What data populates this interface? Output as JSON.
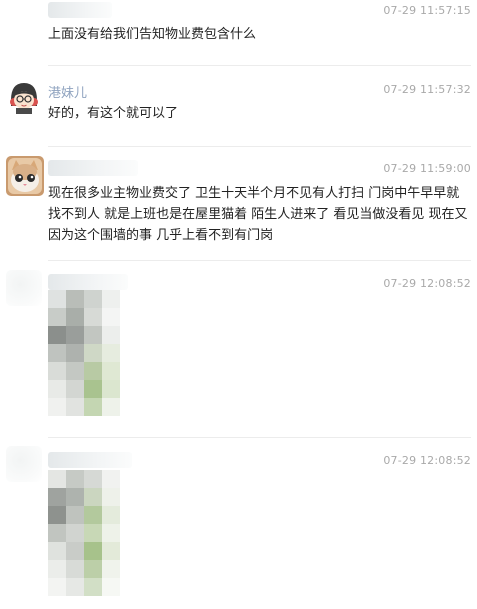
{
  "comments": [
    {
      "author": "",
      "time": "07-29 11:57:15",
      "text": "上面没有给我们告知物业费包含什么"
    },
    {
      "author": "港妹儿",
      "time": "07-29 11:57:32",
      "text": "好的，有这个就可以了"
    },
    {
      "author": "",
      "time": "07-29 11:59:00",
      "text": "现在很多业主物业费交了 卫生十天半个月不见有人打扫 门岗中午早早就找不到人 就是上班也是在屋里猫着 陌生人进来了 看见当做没看见 现在又因为这个围墙的事 几乎上看不到有门岗"
    },
    {
      "author": "",
      "time": "07-29 12:08:52",
      "text": "",
      "image": "blurred-image"
    },
    {
      "author": "",
      "time": "07-29 12:08:52",
      "text": "",
      "image": "blurred-image"
    }
  ],
  "icons": {
    "avatar_girl": "cartoon-girl-avatar-icon",
    "avatar_cat": "cat-avatar-icon"
  },
  "colors": {
    "name": "#8fa3bf",
    "time": "#a9a9a9",
    "divider": "#ececec"
  }
}
